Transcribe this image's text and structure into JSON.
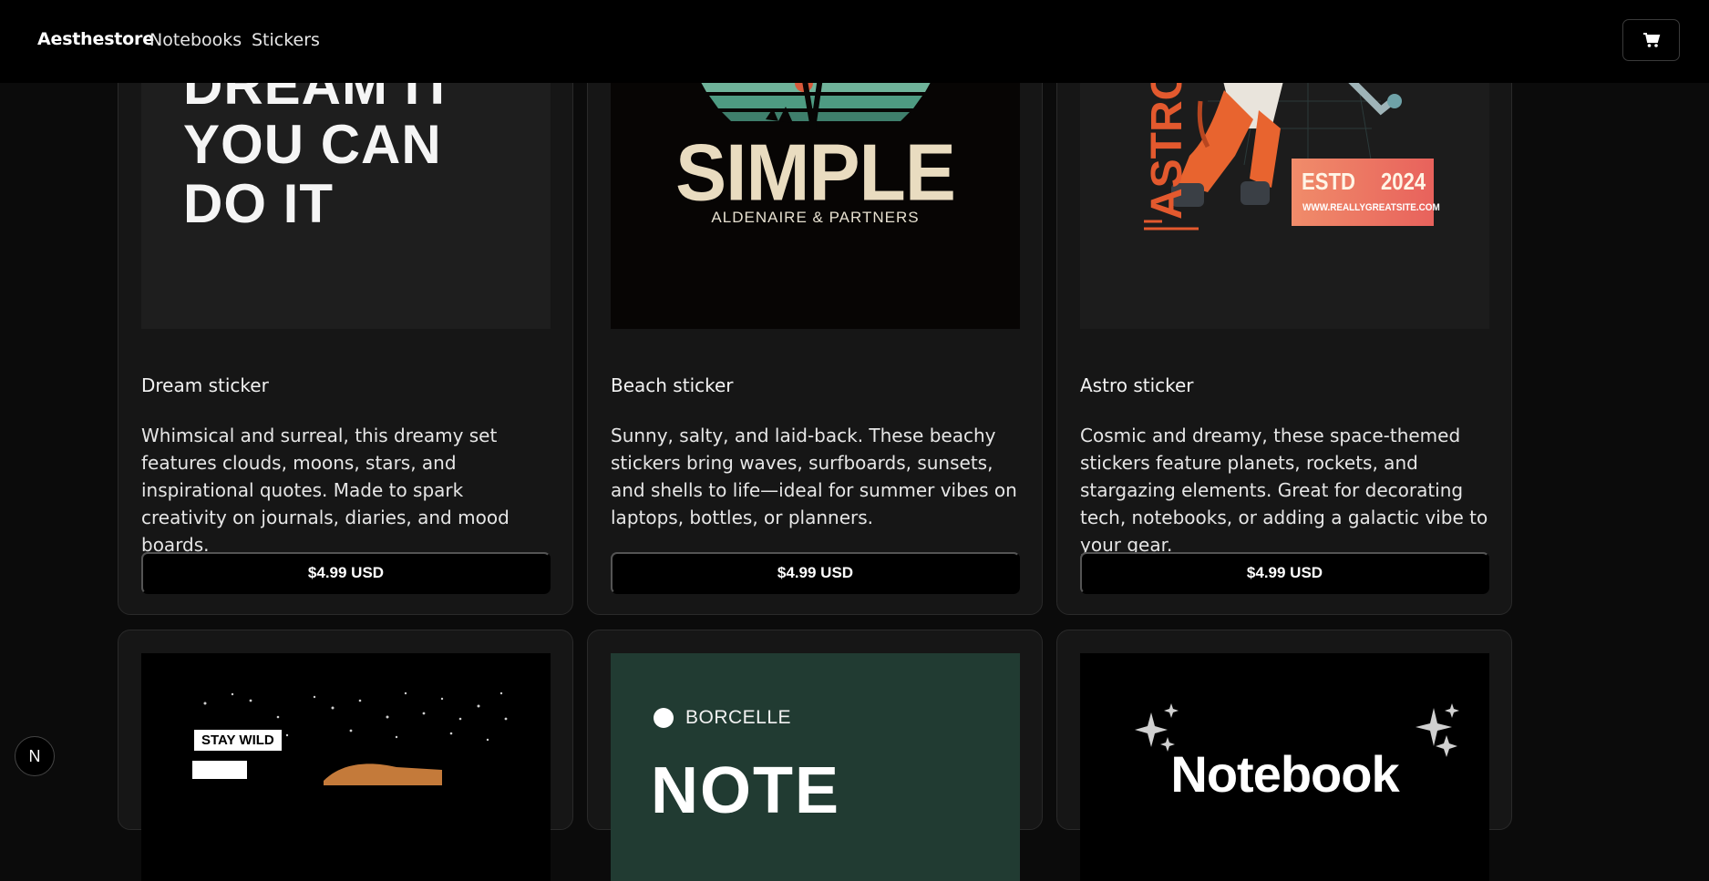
{
  "nav": {
    "brand": "Aesthestore",
    "links": [
      "Notebooks",
      "Stickers"
    ],
    "cart_icon": "cart-icon"
  },
  "products": [
    {
      "title": "Dream sticker",
      "description": "Whimsical and surreal, this dreamy set features clouds, moons, stars, and inspirational quotes. Made to spark creativity on journals, diaries, and mood boards.",
      "price": "$4.99 USD",
      "art_text": "DREAM IT\nYOU CAN\nDO IT"
    },
    {
      "title": "Beach sticker",
      "description": "Sunny, salty, and laid-back. These beachy stickers bring waves, surfboards, sunsets, and shells to life—ideal for summer vibes on laptops, bottles, or planners.",
      "price": "$4.99 USD",
      "art_text": "SIMPLE",
      "art_sub": "ALDENAIRE & PARTNERS"
    },
    {
      "title": "Astro sticker",
      "description": "Cosmic and dreamy, these space-themed stickers feature planets, rockets, and stargazing elements. Great for decorating tech, notebooks, or adding a galactic vibe to your gear.",
      "price": "$4.99 USD",
      "art_side": "ASTRO",
      "art_estd": "ESTD",
      "art_year": "2024",
      "art_url": "WWW.REALLYGREATSITE.COM"
    }
  ],
  "row2": [
    {
      "art_text": "STAY WILD"
    },
    {
      "art_brand": "BORCELLE",
      "art_big": "NOTE"
    },
    {
      "art_text": "Notebook"
    }
  ],
  "badge": "N",
  "colors": {
    "background": "#0b0b0b",
    "card": "#161616",
    "topbar": "#000000",
    "beach_green": "#4e9b82",
    "astro_orange": "#e3592e",
    "note_green": "#213b32"
  }
}
